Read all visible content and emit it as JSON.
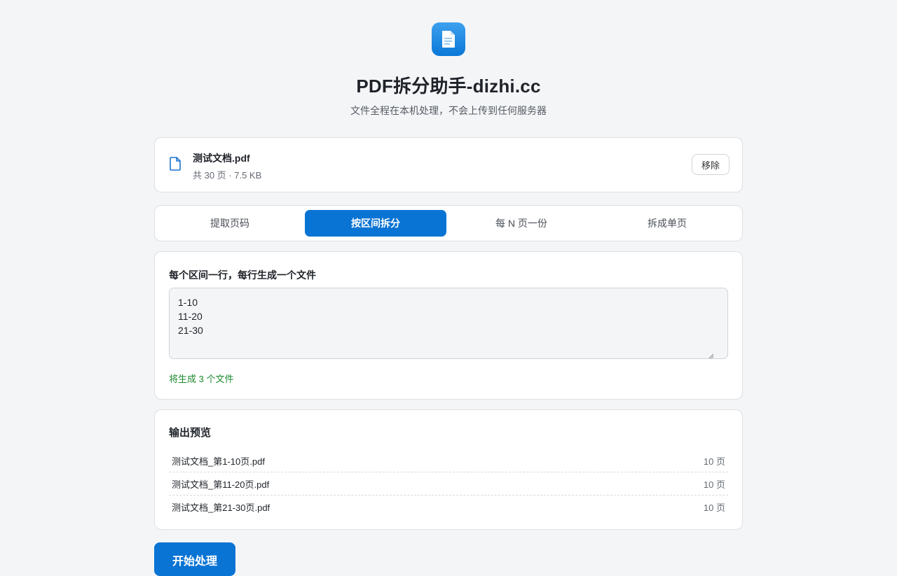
{
  "header": {
    "logo_icon": "document-icon",
    "title": "PDF拆分助手-dizhi.cc",
    "subtitle": "文件全程在本机处理，不会上传到任何服务器"
  },
  "file": {
    "icon": "file-icon",
    "name": "测试文档.pdf",
    "meta": "共 30 页 · 7.5 KB",
    "remove_label": "移除"
  },
  "tabs": [
    {
      "label": "提取页码",
      "active": false
    },
    {
      "label": "按区间拆分",
      "active": true
    },
    {
      "label": "每 N 页一份",
      "active": false
    },
    {
      "label": "拆成单页",
      "active": false
    }
  ],
  "range": {
    "label": "每个区间一行，每行生成一个文件",
    "value": "1-10\n11-20\n21-30",
    "hint": "将生成 3 个文件"
  },
  "preview": {
    "title": "输出预览",
    "rows": [
      {
        "name": "测试文档_第1-10页.pdf",
        "pages": "10 页"
      },
      {
        "name": "测试文档_第11-20页.pdf",
        "pages": "10 页"
      },
      {
        "name": "测试文档_第21-30页.pdf",
        "pages": "10 页"
      }
    ]
  },
  "actions": {
    "start_label": "开始处理"
  },
  "colors": {
    "accent": "#0a74d4",
    "success": "#1a8a2c",
    "background": "#f4f5f7"
  }
}
